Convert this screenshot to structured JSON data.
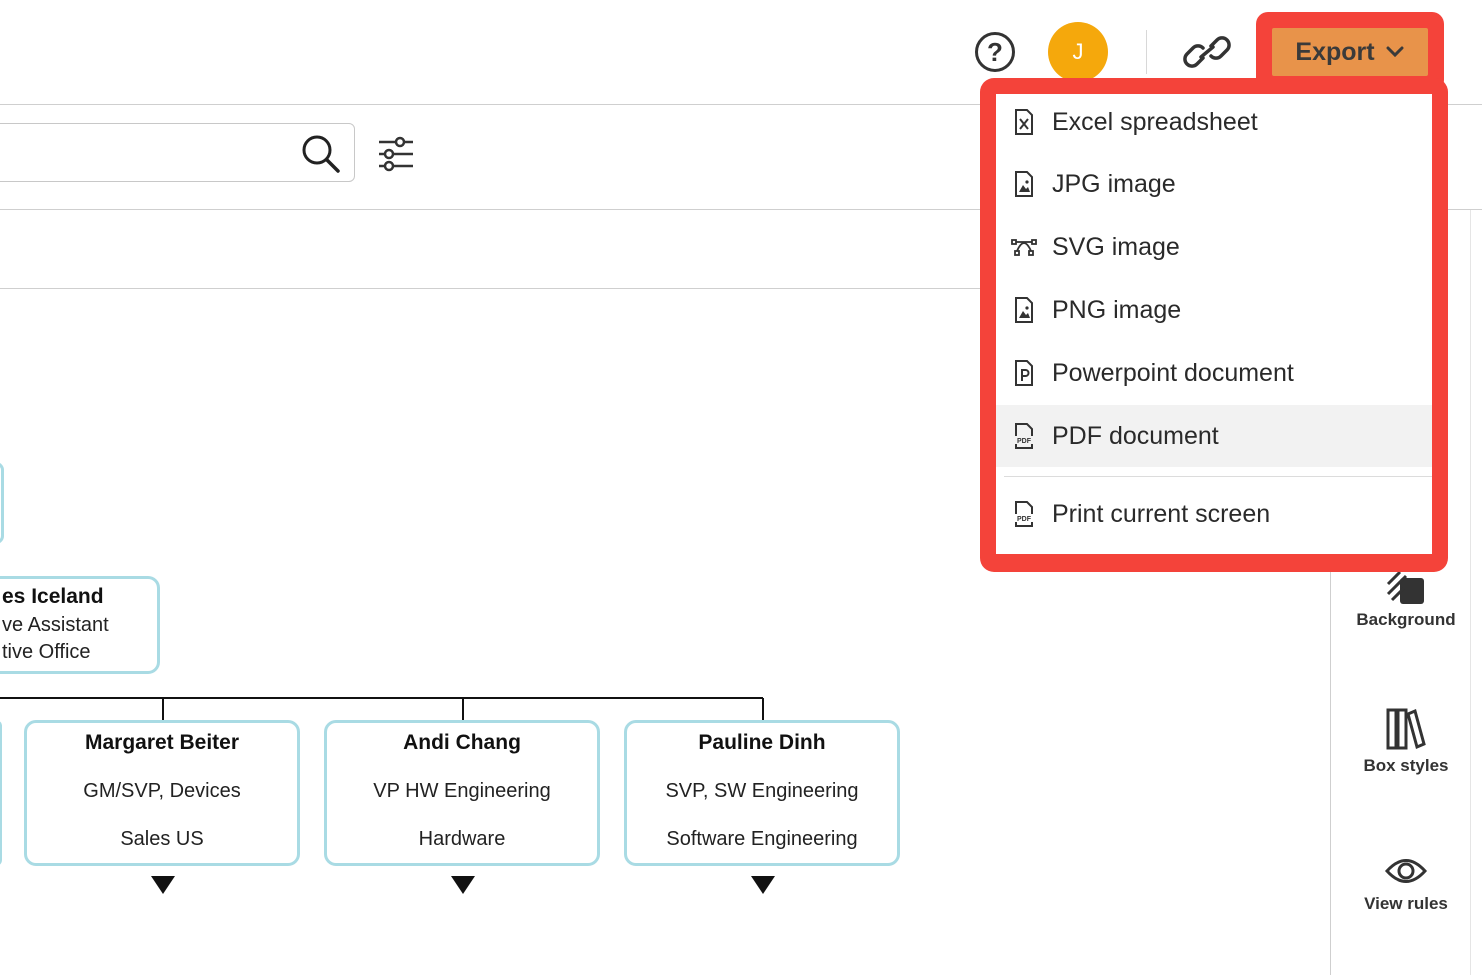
{
  "header": {
    "avatar_initial": "J",
    "help_icon": "question-circle-icon",
    "link_icon": "link-icon",
    "export_label": "Export",
    "export_chevron": "chevron-down-icon"
  },
  "toolbar": {
    "search_placeholder": "",
    "search_icon": "search-icon",
    "filter_icon": "sliders-icon"
  },
  "export_menu": {
    "items": [
      {
        "label": "Excel spreadsheet",
        "icon": "file-excel-icon"
      },
      {
        "label": "JPG image",
        "icon": "file-image-icon"
      },
      {
        "label": "SVG image",
        "icon": "bezier-curve-icon"
      },
      {
        "label": "PNG image",
        "icon": "file-image-icon"
      },
      {
        "label": "Powerpoint document",
        "icon": "file-powerpoint-icon"
      },
      {
        "label": "PDF document",
        "icon": "file-pdf-icon",
        "highlighted": true
      },
      {
        "label": "Print current screen",
        "icon": "file-pdf-icon"
      }
    ]
  },
  "side_panel": {
    "tools": [
      {
        "label": "Background",
        "icon": "background-icon"
      },
      {
        "label": "Box styles",
        "icon": "books-icon"
      },
      {
        "label": "View rules",
        "icon": "eye-icon"
      }
    ]
  },
  "org_chart": {
    "partial_card": {
      "name": "es Iceland",
      "title": "ve Assistant",
      "dept": "tive Office"
    },
    "cards": [
      {
        "name": "Margaret Beiter",
        "title": "GM/SVP, Devices",
        "dept": "Sales US"
      },
      {
        "name": "Andi Chang",
        "title": "VP HW Engineering",
        "dept": "Hardware"
      },
      {
        "name": "Pauline Dinh",
        "title": "SVP, SW Engineering",
        "dept": "Software Engineering"
      }
    ]
  },
  "colors": {
    "highlight_frame": "#f4433a",
    "export_button": "#e8934a",
    "avatar": "#f5a80c",
    "card_border": "#a9dbe4"
  }
}
